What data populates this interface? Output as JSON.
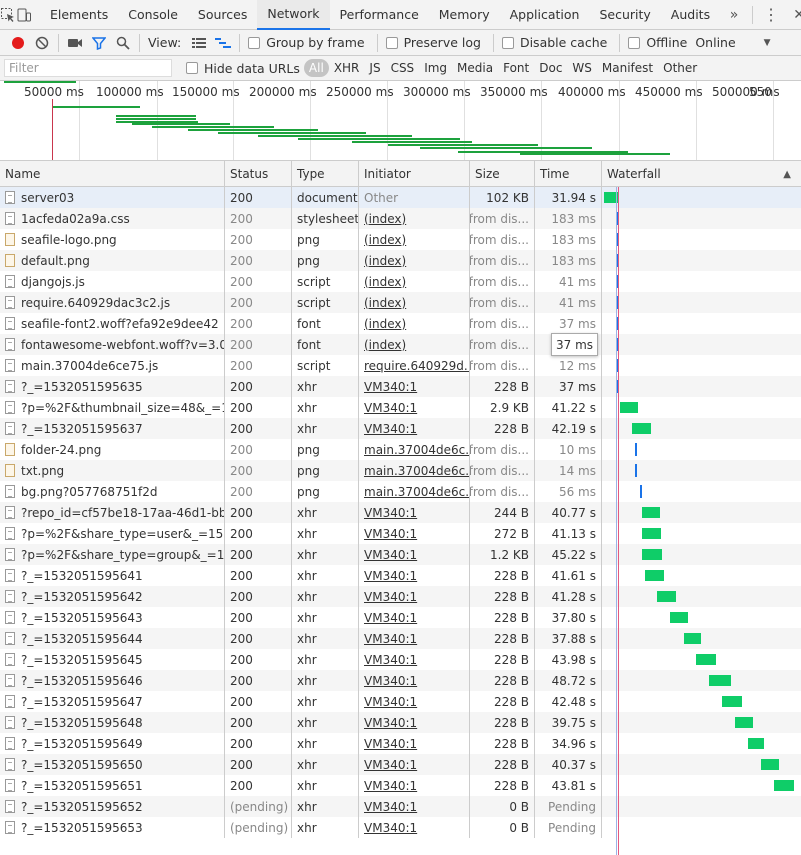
{
  "tabs": [
    {
      "id": "elements",
      "label": "Elements"
    },
    {
      "id": "console",
      "label": "Console"
    },
    {
      "id": "sources",
      "label": "Sources"
    },
    {
      "id": "network",
      "label": "Network",
      "active": true
    },
    {
      "id": "performance",
      "label": "Performance"
    },
    {
      "id": "memory",
      "label": "Memory"
    },
    {
      "id": "application",
      "label": "Application"
    },
    {
      "id": "security",
      "label": "Security"
    },
    {
      "id": "audits",
      "label": "Audits"
    }
  ],
  "tabbar": {
    "more": "»",
    "menu": "⋮",
    "close": "✕"
  },
  "toolbar": {
    "view_label": "View:",
    "group_by_frame": "Group by frame",
    "preserve_log": "Preserve log",
    "disable_cache": "Disable cache",
    "offline": "Offline",
    "throttle": "Online",
    "throttle_arrow": "▼"
  },
  "filter": {
    "placeholder": "Filter",
    "value": "",
    "hide_data_urls": "Hide data URLs",
    "types": [
      {
        "id": "all",
        "label": "All",
        "active": true
      },
      {
        "id": "xhr",
        "label": "XHR"
      },
      {
        "id": "js",
        "label": "JS"
      },
      {
        "id": "css",
        "label": "CSS"
      },
      {
        "id": "img",
        "label": "Img"
      },
      {
        "id": "media",
        "label": "Media"
      },
      {
        "id": "font",
        "label": "Font"
      },
      {
        "id": "doc",
        "label": "Doc"
      },
      {
        "id": "ws",
        "label": "WS"
      },
      {
        "id": "manifest",
        "label": "Manifest"
      },
      {
        "id": "other",
        "label": "Other"
      }
    ]
  },
  "overview": {
    "ticks": [
      "50000 ms",
      "100000 ms",
      "150000 ms",
      "200000 ms",
      "250000 ms",
      "300000 ms",
      "350000 ms",
      "400000 ms",
      "450000 ms",
      "500000 ms",
      "550"
    ]
  },
  "columns": {
    "name": "Name",
    "status": "Status",
    "type": "Type",
    "initiator": "Initiator",
    "size": "Size",
    "time": "Time",
    "waterfall": "Waterfall",
    "sort_arrow": "▲"
  },
  "colors": {
    "accent": "#1a73e8",
    "record": "#e41b1b",
    "filter": "#1a73e8",
    "waterfall_bar": "#0fcd68",
    "overview_bar": "#1da23d",
    "marker_red": "#e3597f"
  },
  "tooltip": "37 ms",
  "rows": [
    {
      "name": "server03",
      "status": "200",
      "type": "document",
      "initiator": "Other",
      "size": "102 KB",
      "time": "31.94 s",
      "icon": "doc",
      "sel": true
    },
    {
      "name": "1acfeda02a9a.css",
      "status": "200",
      "type": "stylesheet",
      "initiator": "(index)",
      "size": "(from dis...",
      "time": "183 ms",
      "icon": "doc"
    },
    {
      "name": "seafile-logo.png",
      "status": "200",
      "type": "png",
      "initiator": "(index)",
      "size": "(from dis...",
      "time": "183 ms",
      "icon": "img"
    },
    {
      "name": "default.png",
      "status": "200",
      "type": "png",
      "initiator": "(index)",
      "size": "(from dis...",
      "time": "183 ms",
      "icon": "img"
    },
    {
      "name": "djangojs.js",
      "status": "200",
      "type": "script",
      "initiator": "(index)",
      "size": "(from dis...",
      "time": "41 ms",
      "icon": "doc"
    },
    {
      "name": "require.640929dac3c2.js",
      "status": "200",
      "type": "script",
      "initiator": "(index)",
      "size": "(from dis...",
      "time": "41 ms",
      "icon": "doc"
    },
    {
      "name": "seafile-font2.woff?efa92e9dee42",
      "status": "200",
      "type": "font",
      "initiator": "(index)",
      "size": "(from dis...",
      "time": "37 ms",
      "icon": "doc",
      "hover": true
    },
    {
      "name": "fontawesome-webfont.woff?v=3.0....",
      "status": "200",
      "type": "font",
      "initiator": "(index)",
      "size": "(from dis...",
      "time": "",
      "icon": "doc"
    },
    {
      "name": "main.37004de6ce75.js",
      "status": "200",
      "type": "script",
      "initiator": "require.640929d...",
      "size": "(from dis...",
      "time": "12 ms",
      "icon": "doc"
    },
    {
      "name": "?_=1532051595635",
      "status": "200",
      "type": "xhr",
      "initiator": "VM340:1",
      "size": "228 B",
      "time": "37 ms",
      "icon": "doc"
    },
    {
      "name": "?p=%2F&thumbnail_size=48&_=1...",
      "status": "200",
      "type": "xhr",
      "initiator": "VM340:1",
      "size": "2.9 KB",
      "time": "41.22 s",
      "icon": "doc"
    },
    {
      "name": "?_=1532051595637",
      "status": "200",
      "type": "xhr",
      "initiator": "VM340:1",
      "size": "228 B",
      "time": "42.19 s",
      "icon": "doc"
    },
    {
      "name": "folder-24.png",
      "status": "200",
      "type": "png",
      "initiator": "main.37004de6c...",
      "size": "(from dis...",
      "time": "10 ms",
      "icon": "img"
    },
    {
      "name": "txt.png",
      "status": "200",
      "type": "png",
      "initiator": "main.37004de6c...",
      "size": "(from dis...",
      "time": "14 ms",
      "icon": "img"
    },
    {
      "name": "bg.png?057768751f2d",
      "status": "200",
      "type": "png",
      "initiator": "main.37004de6c...",
      "size": "(from dis...",
      "time": "56 ms",
      "icon": "doc"
    },
    {
      "name": "?repo_id=cf57be18-17aa-46d1-bb...",
      "status": "200",
      "type": "xhr",
      "initiator": "VM340:1",
      "size": "244 B",
      "time": "40.77 s",
      "icon": "doc"
    },
    {
      "name": "?p=%2F&share_type=user&_=153...",
      "status": "200",
      "type": "xhr",
      "initiator": "VM340:1",
      "size": "272 B",
      "time": "41.13 s",
      "icon": "doc"
    },
    {
      "name": "?p=%2F&share_type=group&_=15...",
      "status": "200",
      "type": "xhr",
      "initiator": "VM340:1",
      "size": "1.2 KB",
      "time": "45.22 s",
      "icon": "doc"
    },
    {
      "name": "?_=1532051595641",
      "status": "200",
      "type": "xhr",
      "initiator": "VM340:1",
      "size": "228 B",
      "time": "41.61 s",
      "icon": "doc"
    },
    {
      "name": "?_=1532051595642",
      "status": "200",
      "type": "xhr",
      "initiator": "VM340:1",
      "size": "228 B",
      "time": "41.28 s",
      "icon": "doc"
    },
    {
      "name": "?_=1532051595643",
      "status": "200",
      "type": "xhr",
      "initiator": "VM340:1",
      "size": "228 B",
      "time": "37.80 s",
      "icon": "doc"
    },
    {
      "name": "?_=1532051595644",
      "status": "200",
      "type": "xhr",
      "initiator": "VM340:1",
      "size": "228 B",
      "time": "37.88 s",
      "icon": "doc"
    },
    {
      "name": "?_=1532051595645",
      "status": "200",
      "type": "xhr",
      "initiator": "VM340:1",
      "size": "228 B",
      "time": "43.98 s",
      "icon": "doc"
    },
    {
      "name": "?_=1532051595646",
      "status": "200",
      "type": "xhr",
      "initiator": "VM340:1",
      "size": "228 B",
      "time": "48.72 s",
      "icon": "doc"
    },
    {
      "name": "?_=1532051595647",
      "status": "200",
      "type": "xhr",
      "initiator": "VM340:1",
      "size": "228 B",
      "time": "42.48 s",
      "icon": "doc"
    },
    {
      "name": "?_=1532051595648",
      "status": "200",
      "type": "xhr",
      "initiator": "VM340:1",
      "size": "228 B",
      "time": "39.75 s",
      "icon": "doc"
    },
    {
      "name": "?_=1532051595649",
      "status": "200",
      "type": "xhr",
      "initiator": "VM340:1",
      "size": "228 B",
      "time": "34.96 s",
      "icon": "doc"
    },
    {
      "name": "?_=1532051595650",
      "status": "200",
      "type": "xhr",
      "initiator": "VM340:1",
      "size": "228 B",
      "time": "40.37 s",
      "icon": "doc"
    },
    {
      "name": "?_=1532051595651",
      "status": "200",
      "type": "xhr",
      "initiator": "VM340:1",
      "size": "228 B",
      "time": "43.81 s",
      "icon": "doc"
    },
    {
      "name": "?_=1532051595652",
      "status": "(pending)",
      "type": "xhr",
      "initiator": "VM340:1",
      "size": "0 B",
      "time": "Pending",
      "icon": "doc"
    },
    {
      "name": "?_=1532051595653",
      "status": "(pending)",
      "type": "xhr",
      "initiator": "VM340:1",
      "size": "0 B",
      "time": "Pending",
      "icon": "doc"
    }
  ]
}
